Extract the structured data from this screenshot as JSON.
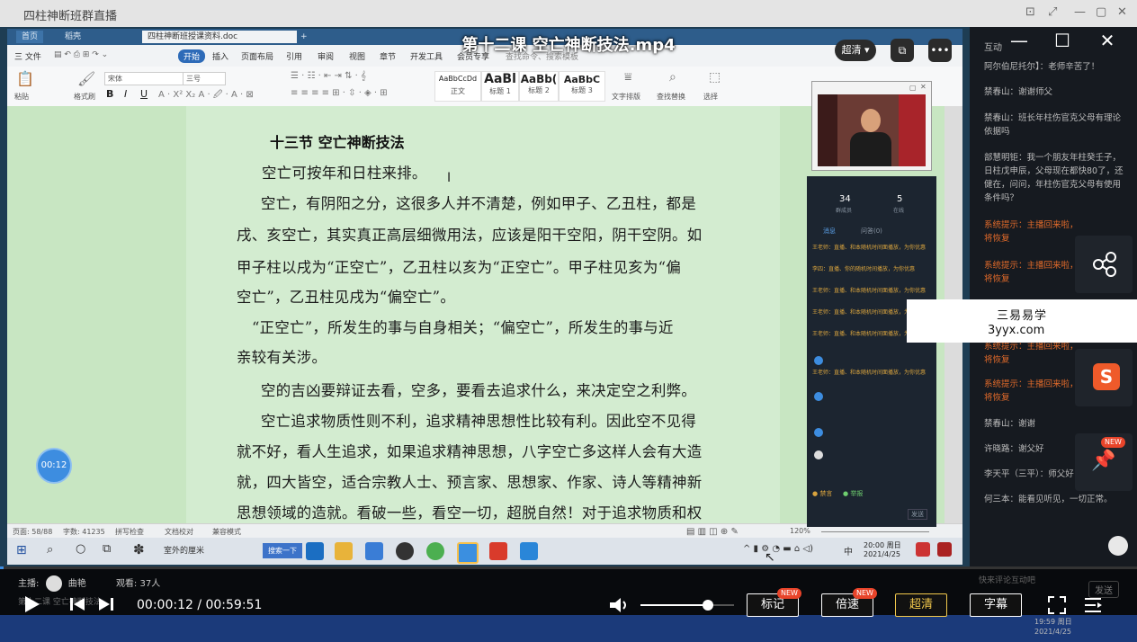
{
  "window": {
    "title": "四柱神断班群直播"
  },
  "video": {
    "title": "第十二课 空亡神断技法.mp4",
    "quality_button": "超清",
    "quality_arrow": "▾"
  },
  "wps": {
    "tabs": [
      "首页",
      "稻壳",
      "四柱神断班授课资料.doc"
    ],
    "menu": [
      "三 文件",
      "开始",
      "插入",
      "页面布局",
      "引用",
      "审阅",
      "视图",
      "章节",
      "开发工具",
      "会员专享",
      "查找命令、搜索模板"
    ],
    "active_menu": "开始",
    "ribbon": {
      "paste": "粘贴",
      "format_painter": "格式刷",
      "font_name": "宋体",
      "font_size": "三号",
      "bold": "B",
      "italic": "I",
      "underline": "U",
      "styles": [
        {
          "sample": "AaBbCcDd",
          "label": "正文"
        },
        {
          "sample": "AaBl",
          "label": "标题 1"
        },
        {
          "sample": "AaBb(",
          "label": "标题 2"
        },
        {
          "sample": "AaBbC",
          "label": "标题 3"
        }
      ],
      "text_layout": "文字排版",
      "find_replace": "查找替换",
      "select": "选择"
    },
    "document": {
      "heading": "十三节 空亡神断技法",
      "lines": [
        "空亡可按年和日柱来排。",
        "空亡，有阴阳之分，这很多人并不清楚，例如甲子、乙丑柱，都是",
        "戌、亥空亡，其实真正高层细微用法，应该是阳干空阳，阴干空阴。如",
        "甲子柱以戌为“正空亡”，乙丑柱以亥为“正空亡”。甲子柱见亥为“偏",
        "空亡”，乙丑柱见戌为“偏空亡”。",
        "“正空亡”，所发生的事与自身相关；“偏空亡”，所发生的事与近",
        "亲较有关涉。",
        "空的吉凶要辩证去看，空多，要看去追求什么，来决定空之利弊。",
        "空亡追求物质性则不利，追求精神思想性比较有利。因此空不见得",
        "就不好，看人生追求，如果追求精神思想，八字空亡多这样人会有大造",
        "就，四大皆空，适合宗教人士、预言家、思想家、作家、诗人等精神新",
        "思想领域的造就。看破一些，看空一切，超脱自然！对于追求物质和权"
      ]
    },
    "statusbar": {
      "page": "页面: 58/88",
      "words": "字数: 41235",
      "spell": "拼写检查",
      "proof": "文档校对",
      "compat": "兼容模式",
      "zoom": "120%"
    },
    "taskbar": {
      "clock_time": "20:00 周日",
      "clock_date": "2021/4/25",
      "ime": "中",
      "search_label": "搜索一下",
      "window_label": "室外的厘米"
    }
  },
  "chat_panel": {
    "count1": "34",
    "count1_label": "群成员",
    "count2": "5",
    "count2_label": "在线",
    "tab1": "消息",
    "tab2": "问答(0)",
    "messages": [
      "王老师：直播、和本随机时间面播放，为你优惠",
      "李四：直播、你的随机时间播放，为你优惠",
      "王老师：直播、和本随机时间面播放，为你优惠",
      "王老师：直播、和本随机时间面播放，为你优惠",
      "王老师：直播、和本随机时间面播放，为你优惠",
      "王老师：直播、和本随机时间面播放，为你优惠"
    ],
    "bottom_left": "● 禁言",
    "bottom_mid": "● 举报",
    "send": "发送"
  },
  "sidebar": {
    "header": "互动",
    "messages": [
      {
        "text": "阿尔伯尼托尔】：老师辛苦了！",
        "sys": false
      },
      {
        "text": "禁春山：谢谢师父",
        "sys": false
      },
      {
        "text": "禁春山：班长年柱伤官克父母有理论依据吗",
        "sys": false
      },
      {
        "text": "部慧明钜：我一个朋友年柱癸壬子，日柱戊申辰，父母现在都快80了，还健在，问问，年柱伤官克父母有使用条件吗？",
        "sys": false
      },
      {
        "text": "系统提示：主播回来啦，",
        "sys": true
      },
      {
        "text": "系统提示：主播回来啦，",
        "sys": true
      },
      {
        "text": "系统提示：主播回来啦，",
        "sys": true
      },
      {
        "text": "系统提示：主播回来啦，",
        "sys": true
      },
      {
        "text": "禁春山：谢谢",
        "sys": false
      },
      {
        "text": "许晓路：谢父好",
        "sys": false
      },
      {
        "text": "李天平（三平）：师父好",
        "sys": false
      },
      {
        "text": "何三本：能看见听见，一切正常。",
        "sys": false
      }
    ],
    "sys_suffix": "将恢复",
    "input_placeholder": "快来评论互动吧",
    "send": "发送"
  },
  "watermark": {
    "line1": "三易易学",
    "line2": "3yyx.com"
  },
  "timer_bubble": "00:12",
  "player": {
    "host_label": "主播:",
    "host_name": "曲艳",
    "viewers_label": "观看:",
    "viewers": "37人",
    "time": "00:00:12 / 00:59:51",
    "progress": 0.0033,
    "volume": 0.72,
    "buttons": {
      "mark": "标记",
      "speed": "倍速",
      "quality": "超清",
      "subtitle": "字幕"
    },
    "new_tag": "NEW",
    "bottom_clock": "19:59 周日",
    "bottom_date": "2021/4/25",
    "bottom_caption": "第十二课 空亡神断技法"
  },
  "colors": {
    "doc_bg": "#c8e6c2",
    "sidebar_bg": "#161a20",
    "accent": "#2e6bb8",
    "system_msg": "#e06a2a",
    "new_tag": "#e8442a"
  }
}
